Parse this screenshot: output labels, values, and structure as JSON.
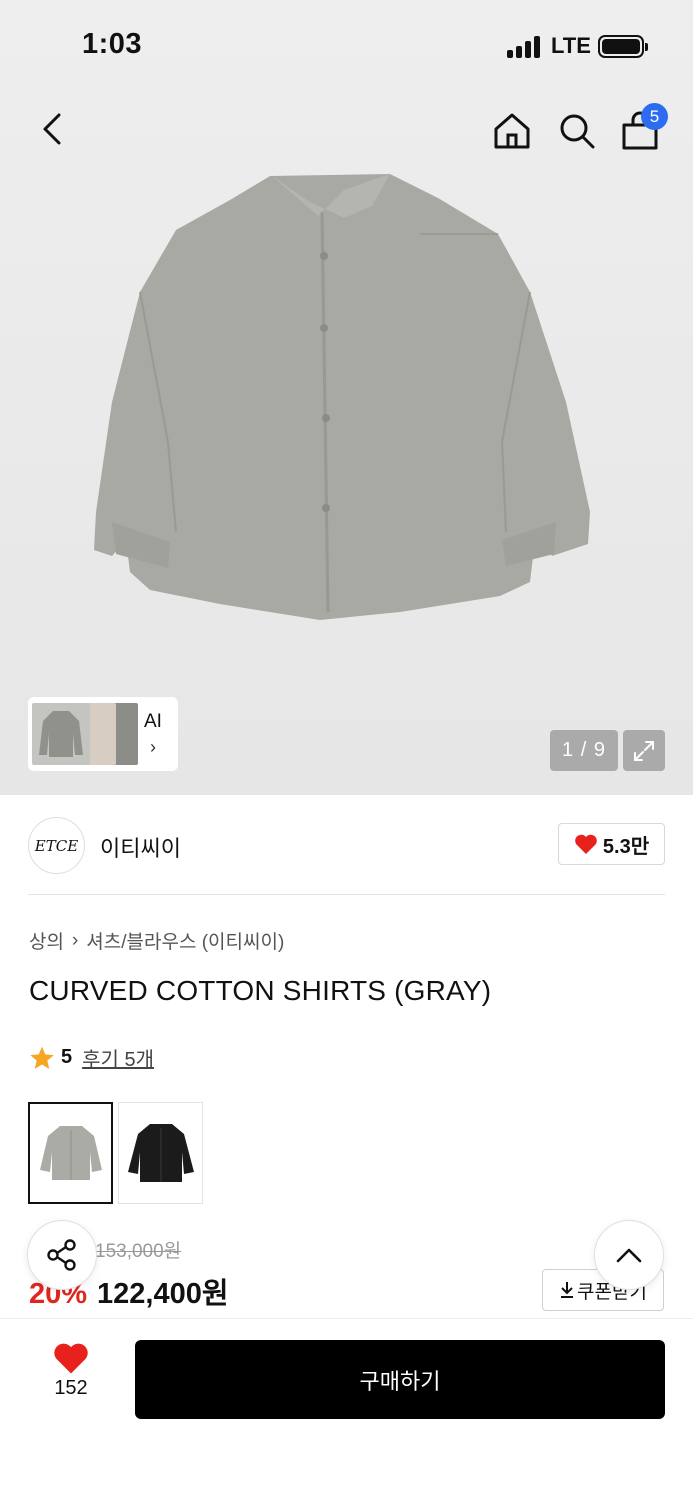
{
  "status_bar": {
    "time": "1:03",
    "network": "LTE"
  },
  "header": {
    "cart_count": "5"
  },
  "gallery": {
    "ai_label": "AI",
    "ai_chevron": "›",
    "pager": "1 / 9"
  },
  "brand": {
    "logo_text": "ETCE",
    "name": "이티씨이",
    "likes": "5.3만"
  },
  "breadcrumb": {
    "category": "상의",
    "separator": "›",
    "subcategory": "셔츠/블라우스 (이티씨이)"
  },
  "product": {
    "title": "CURVED COTTON SHIRTS (GRAY)",
    "rating": "5",
    "reviews": "후기 5개"
  },
  "colors": [
    {
      "name": "gray",
      "hex": "#a9aba4"
    },
    {
      "name": "black",
      "hex": "#1b1b1b"
    }
  ],
  "price": {
    "original": "153,000원",
    "discount": "20%",
    "sale": "122,400원",
    "coupon_label": "쿠폰받기"
  },
  "bottom_bar": {
    "wish_count": "152",
    "buy_label": "구매하기"
  },
  "icons": [
    "back-icon",
    "home-icon",
    "search-icon",
    "bag-icon",
    "expand-icon",
    "heart-icon",
    "star-icon",
    "share-icon",
    "chevron-up-icon",
    "download-icon"
  ]
}
